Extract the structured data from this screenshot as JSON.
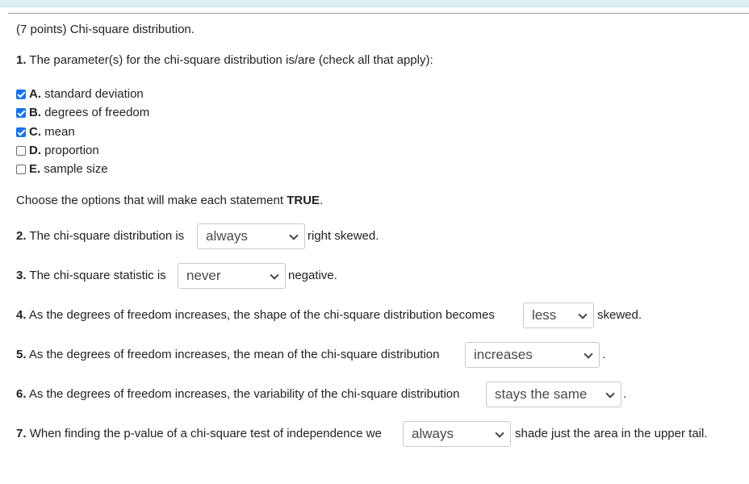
{
  "header": {
    "title": "(7 points) Chi-square distribution."
  },
  "q1": {
    "number": "1.",
    "text": "The parameter(s) for the chi-square distribution is/are (check all that apply):",
    "options": [
      {
        "letter": "A.",
        "label": "standard deviation",
        "checked": true
      },
      {
        "letter": "B.",
        "label": "degrees of freedom",
        "checked": true
      },
      {
        "letter": "C.",
        "label": "mean",
        "checked": true
      },
      {
        "letter": "D.",
        "label": "proportion",
        "checked": false
      },
      {
        "letter": "E.",
        "label": "sample size",
        "checked": false
      }
    ]
  },
  "instruction": {
    "text": "Choose the options that will make each statement",
    "bold": "TRUE",
    "end": "."
  },
  "questions": [
    {
      "number": "2.",
      "before": "The chi-square distribution is",
      "selected": "always",
      "after": "right skewed."
    },
    {
      "number": "3.",
      "before": "The chi-square statistic is",
      "selected": "never",
      "after": "negative."
    },
    {
      "number": "4.",
      "before": "As the degrees of freedom increases, the shape of the chi-square distribution becomes",
      "selected": "less",
      "after": "skewed."
    },
    {
      "number": "5.",
      "before": "As the degrees of freedom increases, the mean of the chi-square distribution",
      "selected": "increases",
      "after": "."
    },
    {
      "number": "6.",
      "before": "As the degrees of freedom increases, the variability of the chi-square distribution",
      "selected": "stays the same",
      "after": "."
    },
    {
      "number": "7.",
      "before": "When finding the p-value of a chi-square test of independence we",
      "selected": "always",
      "after": "shade just the area in the upper tail."
    }
  ]
}
